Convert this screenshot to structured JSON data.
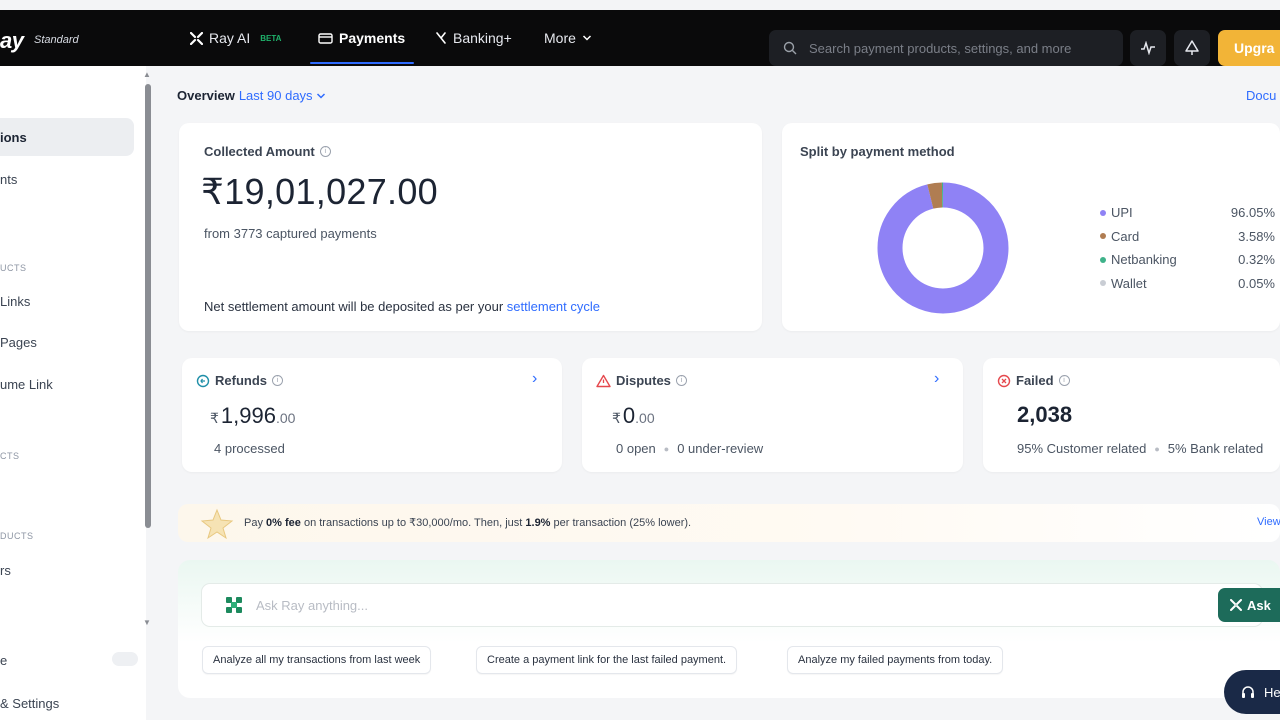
{
  "brand": {
    "logo": "ay",
    "plan": "Standard"
  },
  "nav": {
    "ray_ai": "Ray AI",
    "ray_ai_badge": "BETA",
    "payments": "Payments",
    "banking": "Banking+",
    "more": "More"
  },
  "search": {
    "placeholder": "Search payment products, settings, and more"
  },
  "upgrade_label": "Upgra",
  "sidebar": {
    "items": [
      {
        "label": "ions"
      },
      {
        "label": "nts"
      },
      {
        "label": "Links"
      },
      {
        "label": "Pages"
      },
      {
        "label": "ume Link"
      },
      {
        "label": "rs"
      },
      {
        "label": "e"
      },
      {
        "label": "& Settings"
      }
    ],
    "sections": [
      "UCTS",
      "CTS",
      "DUCTS"
    ]
  },
  "overview": {
    "label": "Overview",
    "range": "Last 90 days",
    "docs_link": "Docu"
  },
  "collected": {
    "title": "Collected Amount",
    "amount": "₹19,01,027.00",
    "subtitle": "from 3773 captured payments",
    "settlement_text": "Net settlement amount will be deposited as per your",
    "settlement_link": "settlement cycle"
  },
  "split": {
    "title": "Split by payment method",
    "methods": [
      {
        "name": "UPI",
        "percent": "96.05%",
        "color": "#8f82f5"
      },
      {
        "name": "Card",
        "percent": "3.58%",
        "color": "#b07d52"
      },
      {
        "name": "Netbanking",
        "percent": "0.32%",
        "color": "#3fb28a"
      },
      {
        "name": "Wallet",
        "percent": "0.05%",
        "color": "#c9cdd4"
      }
    ]
  },
  "refunds": {
    "title": "Refunds",
    "currency": "₹",
    "amount": "1,996",
    "decimals": ".00",
    "sub": "4 processed"
  },
  "disputes": {
    "title": "Disputes",
    "currency": "₹",
    "amount": "0",
    "decimals": ".00",
    "open": "0 open",
    "under_review": "0 under-review"
  },
  "failed": {
    "title": "Failed",
    "count": "2,038",
    "customer": "95% Customer related",
    "bank": "5% Bank related"
  },
  "promo": {
    "pre": "Pay",
    "fee": "0% fee",
    "mid": "on transactions up to ₹30,000/mo. Then, just",
    "rate": "1.9%",
    "post": "per transaction (25% lower).",
    "view": "View"
  },
  "ai": {
    "placeholder": "Ask Ray anything...",
    "ask_label": "Ask",
    "suggestions": [
      "Analyze all my transactions from last week",
      "Create a payment link for the last failed payment.",
      "Analyze my failed payments from today."
    ]
  },
  "help_label": "He",
  "colors": {
    "accent": "#2f6cff",
    "upgrade": "#f2b437",
    "ask": "#1d6b5a"
  }
}
